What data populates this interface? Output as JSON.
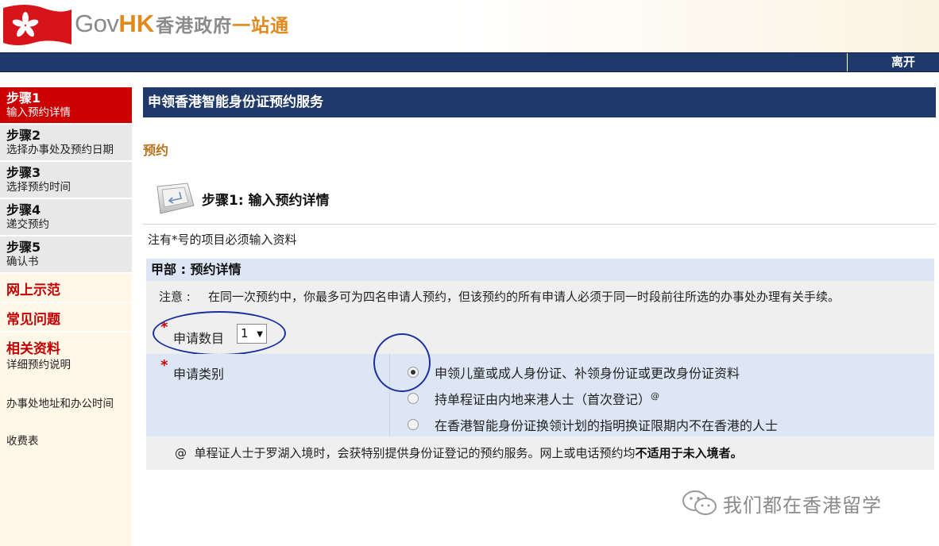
{
  "header": {
    "logo_gov": "Gov",
    "logo_hk": "HK",
    "logo_cn_grey": "香港政府",
    "logo_cn_orange": "一站通"
  },
  "navbar": {
    "leave_label": "离开"
  },
  "sidebar": {
    "steps": [
      {
        "title": "步骤1",
        "desc": "输入预约详情",
        "active": true
      },
      {
        "title": "步骤2",
        "desc": "选择办事处及预约日期",
        "active": false
      },
      {
        "title": "步骤3",
        "desc": "选择预约时间",
        "active": false
      },
      {
        "title": "步骤4",
        "desc": "递交预约",
        "active": false
      },
      {
        "title": "步骤5",
        "desc": "确认书",
        "active": false
      }
    ],
    "links": {
      "demo": "网上示范",
      "faq": "常见问题",
      "related": "相关资料"
    },
    "sub_links": [
      "详细预约说明",
      "办事处地址和办公时间",
      "收费表"
    ]
  },
  "main": {
    "title": "申领香港智能身份证预约服务",
    "section_label": "预约",
    "step_heading": "步骤1: 输入预约详情",
    "required_note": "注有*号的项目必须输入资料",
    "form": {
      "head": "甲部 : 预约详情",
      "notice_label": "注意 :",
      "notice_text": "在同一次预约中，你最多可为四名申请人预约，但该预约的所有申请人必须于同一时段前往所选的办事处办理有关手续。",
      "required_star": "*",
      "count_label": "申请数目",
      "count_value": "1",
      "type_label": "申请类别",
      "options": [
        {
          "text": "申领儿童或成人身份证、补领身份证或更改身份证资料",
          "checked": true,
          "sup": ""
        },
        {
          "text": "持单程证由内地来港人士（首次登记）",
          "checked": false,
          "sup": "@"
        },
        {
          "text": "在香港智能身份证换领计划的指明换证限期内不在香港的人士",
          "checked": false,
          "sup": ""
        }
      ],
      "foot_marker": "@",
      "foot_text": "单程证人士于罗湖入境时，会获特别提供身份证登记的预约服务。网上或电话预约均",
      "foot_bold": "不适用于未入境者。"
    }
  },
  "watermark": {
    "text": "我们都在香港留学"
  },
  "colors": {
    "navy": "#1f3a6a",
    "active_red": "#cc0000",
    "link_red": "#c00000",
    "section_orange": "#b8721a",
    "annotation_blue": "#1a2fa0"
  }
}
